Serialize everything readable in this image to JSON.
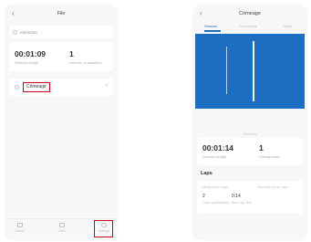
{
  "left_screen": {
    "back": "‹",
    "title": "File",
    "meta_row": {
      "label": "Metadata"
    },
    "stats": [
      {
        "value": "00:01:09",
        "label": "Session length"
      },
      {
        "value": "1",
        "label": "Number of sessions"
      }
    ],
    "session": {
      "label": "Crimeage",
      "chevron": "›"
    },
    "nav": [
      {
        "label": "Home",
        "icon": "home-icon"
      },
      {
        "label": "Files",
        "icon": "folder-icon"
      },
      {
        "label": "Settings",
        "icon": "gear-icon"
      }
    ],
    "highlight_color": "#d0021b"
  },
  "right_screen": {
    "back": "‹",
    "title": "Crimeage",
    "tabs": [
      {
        "label": "Session",
        "active": true
      },
      {
        "label": "Comments",
        "active": false
      },
      {
        "label": "Share",
        "active": false
      }
    ],
    "graph_color": "#1b6ec2",
    "hint": "Overview",
    "stats": [
      {
        "value": "00:01:14",
        "label": "Session length"
      },
      {
        "value": "1",
        "label": "Checkpoints"
      }
    ],
    "laps_title": "Laps",
    "laps": {
      "headers": [
        "Measured in Laps",
        "Show info for all Laps"
      ],
      "values": [
        "2",
        "0:14"
      ],
      "subs": [
        "Total Laps/Session",
        "Best Lap Time"
      ]
    }
  }
}
